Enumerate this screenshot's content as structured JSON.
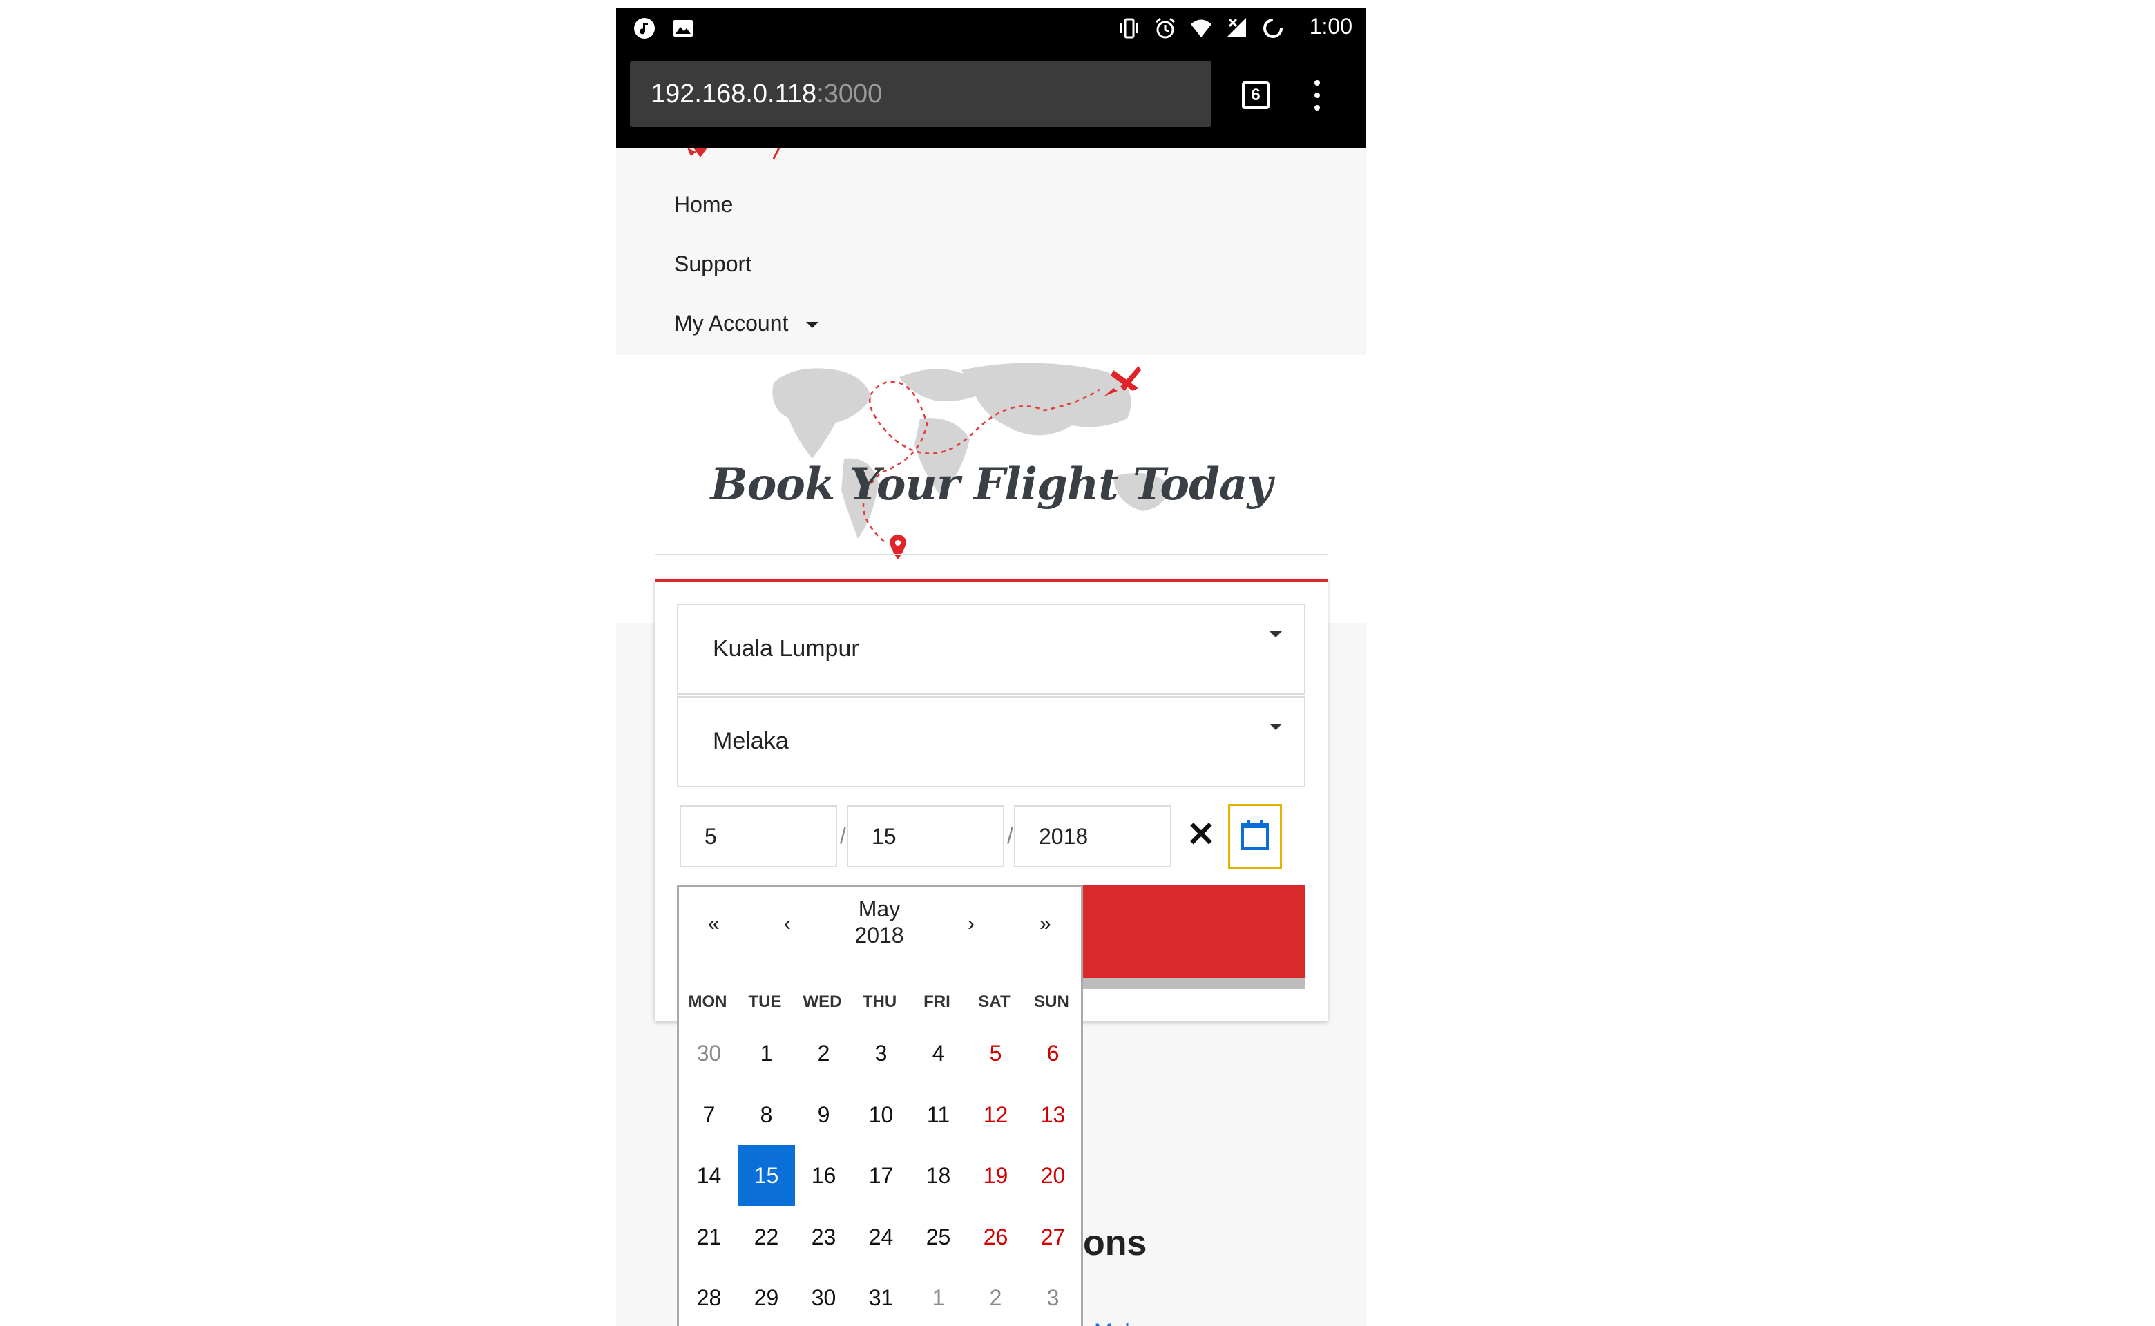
{
  "status_bar": {
    "time": "1:00",
    "icons_left": [
      "music-notification-icon",
      "image-notification-icon"
    ],
    "icons_right": [
      "vibrate-icon",
      "alarm-icon",
      "wifi-icon",
      "signal-icon",
      "loading-icon"
    ]
  },
  "browser": {
    "url_host": "192.168.0.118",
    "url_port": ":3000",
    "tab_count": "6"
  },
  "nav": {
    "items": [
      {
        "label": "Home"
      },
      {
        "label": "Support"
      },
      {
        "label": "My Account"
      }
    ]
  },
  "hero": {
    "title": "Book Your Flight Today"
  },
  "form": {
    "from": "Kuala Lumpur",
    "to": "Melaka",
    "date": {
      "month": "5",
      "day": "15",
      "year": "2018",
      "separator": "/"
    },
    "clear_symbol": "✕"
  },
  "calendar": {
    "prev_year": "«",
    "prev_month": "‹",
    "next_month": "›",
    "next_year": "»",
    "month": "May",
    "year": "2018",
    "weekdays": [
      "MON",
      "TUE",
      "WED",
      "THU",
      "FRI",
      "SAT",
      "SUN"
    ],
    "weeks": [
      [
        "30",
        "1",
        "2",
        "3",
        "4",
        "5",
        "6"
      ],
      [
        "7",
        "8",
        "9",
        "10",
        "11",
        "12",
        "13"
      ],
      [
        "14",
        "15",
        "16",
        "17",
        "18",
        "19",
        "20"
      ],
      [
        "21",
        "22",
        "23",
        "24",
        "25",
        "26",
        "27"
      ],
      [
        "28",
        "29",
        "30",
        "31",
        "1",
        "2",
        "3"
      ]
    ],
    "selected_day": "15"
  },
  "page_fragments": {
    "section_heading_visible": "ons",
    "link_visible": "Mal..."
  },
  "colors": {
    "brand_red": "#d9292a",
    "selected_blue": "#0a6fd6",
    "weekend_red": "#d10000"
  }
}
